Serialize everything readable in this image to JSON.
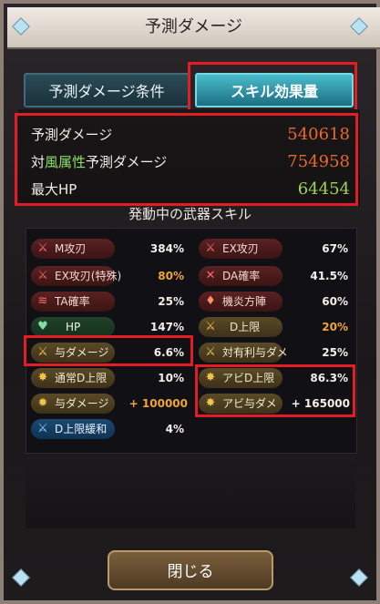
{
  "window": {
    "title": "予測ダメージ",
    "close_label": "閉じる"
  },
  "tabs": [
    {
      "label": "予測ダメージ条件",
      "active": false
    },
    {
      "label": "スキル効果量",
      "active": true
    }
  ],
  "summary": [
    {
      "label": "予測ダメージ",
      "value": "540618",
      "color": "#e8692f"
    },
    {
      "label_prefix": "対",
      "label_accent": "風属性",
      "label_suffix": "予測ダメージ",
      "value": "754958",
      "color": "#e8692f"
    },
    {
      "label": "最大HP",
      "value": "64454",
      "color": "#9ed35a"
    }
  ],
  "skills_title": "発動中の武器スキル",
  "skills": [
    {
      "name": "M攻刃",
      "value": "384%",
      "value_color": "#f3efe8",
      "chip": "red",
      "icon": "sword-icon"
    },
    {
      "name": "EX攻刃",
      "value": "67%",
      "value_color": "#f3efe8",
      "chip": "red",
      "icon": "sword-icon"
    },
    {
      "name": "EX攻刃(特殊)",
      "value": "80%",
      "value_color": "#f0a533",
      "chip": "red",
      "icon": "sword-icon"
    },
    {
      "name": "DA確率",
      "value": "41.5%",
      "value_color": "#f3efe8",
      "chip": "red",
      "icon": "double-slash-icon"
    },
    {
      "name": "TA確率",
      "value": "25%",
      "value_color": "#f3efe8",
      "chip": "red",
      "icon": "triple-slash-icon"
    },
    {
      "name": "機炎方陣",
      "value": "60%",
      "value_color": "#f3efe8",
      "chip": "red",
      "icon": "flame-icon"
    },
    {
      "name": "HP",
      "value": "147%",
      "value_color": "#f3efe8",
      "chip": "green",
      "icon": "heart-icon"
    },
    {
      "name": "D上限",
      "value": "20%",
      "value_color": "#f0a533",
      "chip": "gold",
      "icon": "sword-gold-icon"
    },
    {
      "name": "与ダメージ",
      "value": "6.6%",
      "value_color": "#f3efe8",
      "chip": "gold",
      "icon": "sword-gold-icon"
    },
    {
      "name": "対有利与ダメ",
      "value": "25%",
      "value_color": "#f3efe8",
      "chip": "gold",
      "icon": "sword-gold-icon"
    },
    {
      "name": "通常D上限",
      "value": "10%",
      "value_color": "#f3efe8",
      "chip": "gold",
      "icon": "burst-icon"
    },
    {
      "name": "アビD上限",
      "value": "86.3%",
      "value_color": "#f3efe8",
      "chip": "gold",
      "icon": "burst-icon"
    },
    {
      "name": "与ダメージ",
      "value": "+ 100000",
      "value_color": "#f0a533",
      "chip": "gold",
      "icon": "sun-icon"
    },
    {
      "name": "アビ与ダメ",
      "value": "+ 165000",
      "value_color": "#f3efe8",
      "chip": "gold",
      "icon": "burst-icon"
    },
    {
      "name": "D上限緩和",
      "value": "4%",
      "value_color": "#f3efe8",
      "chip": "blue",
      "icon": "sword-blue-icon"
    }
  ]
}
